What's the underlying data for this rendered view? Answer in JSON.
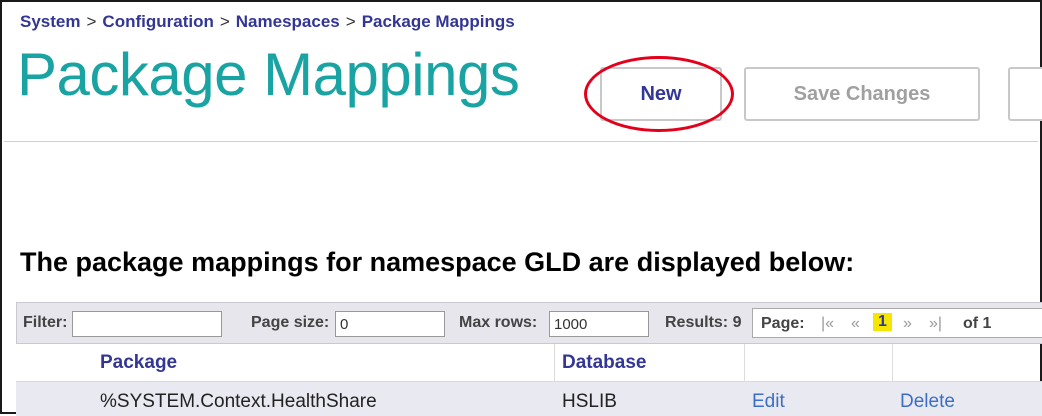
{
  "breadcrumb": {
    "items": [
      "System",
      "Configuration",
      "Namespaces",
      "Package Mappings"
    ],
    "separator": ">"
  },
  "page_title": "Package Mappings",
  "toolbar": {
    "new_label": "New",
    "save_label": "Save Changes"
  },
  "description": "The package mappings for namespace GLD are displayed below:",
  "filter_bar": {
    "filter_label": "Filter:",
    "filter_value": "",
    "page_size_label": "Page size:",
    "page_size_value": "0",
    "max_rows_label": "Max rows:",
    "max_rows_value": "1000",
    "results_label": "Results: 9",
    "page_label": "Page:",
    "first_icon": "|«",
    "prev_icon": "«",
    "current_page": "1",
    "next_icon": "»",
    "last_icon": "»|",
    "of_label": "of 1"
  },
  "table": {
    "columns": [
      "Package",
      "Database",
      "",
      ""
    ],
    "rows": [
      {
        "package": "%SYSTEM.Context.HealthShare",
        "database": "HSLIB",
        "edit": "Edit",
        "delete": "Delete"
      }
    ]
  },
  "colors": {
    "title": "#1aa3a3",
    "link": "#333695",
    "highlight": "#e3001b",
    "current_page_bg": "#f5e600"
  }
}
